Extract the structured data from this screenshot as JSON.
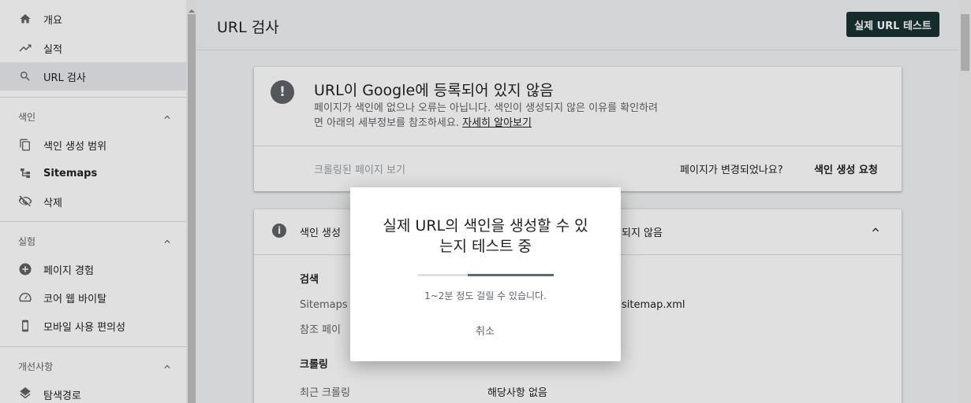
{
  "sidebar": {
    "items_top": [
      {
        "label": "개요",
        "icon": "home-icon"
      },
      {
        "label": "실적",
        "icon": "trending-up-icon"
      },
      {
        "label": "URL 검사",
        "icon": "search-icon"
      }
    ],
    "sections": [
      {
        "label": "색인",
        "items": [
          {
            "label": "색인 생성 범위",
            "icon": "copy-icon"
          },
          {
            "label": "Sitemaps",
            "icon": "sitemap-icon"
          },
          {
            "label": "삭제",
            "icon": "eye-off-icon"
          }
        ]
      },
      {
        "label": "실험",
        "items": [
          {
            "label": "페이지 경험",
            "icon": "plus-circle-icon"
          },
          {
            "label": "코어 웹 바이탈",
            "icon": "speedometer-icon"
          },
          {
            "label": "모바일 사용 편의성",
            "icon": "phone-icon"
          }
        ]
      },
      {
        "label": "개선사항",
        "items": [
          {
            "label": "탐색경로",
            "icon": "layers-icon"
          }
        ]
      }
    ]
  },
  "header": {
    "title": "URL 검사",
    "live_test_label": "실제 URL 테스트"
  },
  "status_card": {
    "title": "URL이 Google에 등록되어 있지 않음",
    "desc_line1": "페이지가 색인에 없으나 오류는 아닙니다. 색인이 생성되지 않은 이유를 확인하려",
    "desc_line2_prefix": "면 아래의 세부정보를 참조하세요.",
    "learn_more": "자세히 알아보기",
    "crawled_page": "크롤링된 페이지 보기",
    "changed_question": "페이지가 변경되었나요?",
    "request_index": "색인 생성 요청"
  },
  "coverage_card": {
    "label": "색인 생성",
    "status": "되지 않음",
    "search_heading": "검색",
    "sitemaps_label": "Sitemaps",
    "sitemaps_value": "sitemap.xml",
    "referring_label": "참조 페이",
    "crawl_heading": "크롤링",
    "last_crawl_label": "최근 크롤링",
    "last_crawl_value": "해당사항 없음"
  },
  "dialog": {
    "title_line1": "실제 URL의 색인을 생성할 수 있",
    "title_line2": "는지 테스트 중",
    "note": "1~2분 정도 걸릴 수 있습니다.",
    "cancel": "취소",
    "progress": 0.63
  },
  "colors": {
    "primary_button": "#1a3133",
    "progress": "#5f6b73"
  }
}
